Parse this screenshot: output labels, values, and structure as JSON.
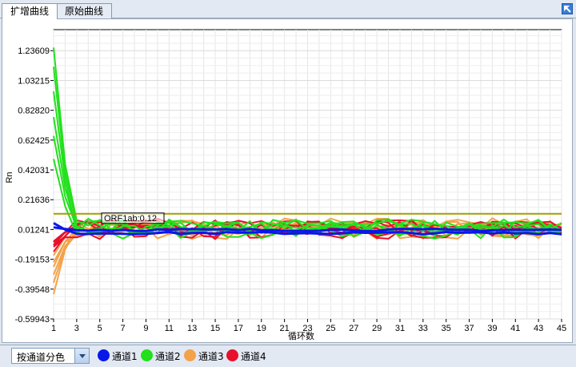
{
  "tabs": [
    {
      "label": "扩增曲线",
      "active": true
    },
    {
      "label": "原始曲线",
      "active": false
    }
  ],
  "toolbar": {
    "corner_icon": "expand-arrow-icon"
  },
  "chart_data": {
    "type": "line",
    "ylabel": "Rn",
    "xlabel": "循环数",
    "xlim": [
      1,
      45
    ],
    "ylim": [
      -0.59943,
      1.38
    ],
    "x_ticks": [
      "1",
      "3",
      "5",
      "7",
      "9",
      "11",
      "13",
      "15",
      "17",
      "19",
      "21",
      "23",
      "25",
      "27",
      "29",
      "31",
      "33",
      "35",
      "37",
      "39",
      "41",
      "43",
      "45"
    ],
    "y_ticks": [
      "1.23609",
      "1.03215",
      "0.82820",
      "0.62425",
      "0.42031",
      "0.21636",
      "0.01241",
      "-0.19153",
      "-0.39548",
      "-0.59943"
    ],
    "threshold": {
      "value": 0.12,
      "color": "#a8a000"
    },
    "annotation": "ORF1ab:0.12",
    "grid": true,
    "series": [
      {
        "name": "通道1",
        "color": "#0a17e8",
        "start": 0.03,
        "baseline": 0.01,
        "noise": 0.008,
        "lines": 2
      },
      {
        "name": "通道2",
        "color": "#22e01c",
        "start": 1.25,
        "baseline": 0.02,
        "noise": 0.05,
        "lines": 6
      },
      {
        "name": "通道3",
        "color": "#f4a24a",
        "start": -0.4,
        "baseline": 0.02,
        "noise": 0.055,
        "lines": 6
      },
      {
        "name": "通道4",
        "color": "#e8102a",
        "start": -0.15,
        "baseline": 0.02,
        "noise": 0.05,
        "lines": 6
      }
    ]
  },
  "bottom": {
    "select_value": "按通道分色",
    "legend": [
      {
        "label": "通道1",
        "color": "#0a17e8"
      },
      {
        "label": "通道2",
        "color": "#22e01c"
      },
      {
        "label": "通道3",
        "color": "#f4a24a"
      },
      {
        "label": "通道4",
        "color": "#e8102a"
      }
    ]
  }
}
